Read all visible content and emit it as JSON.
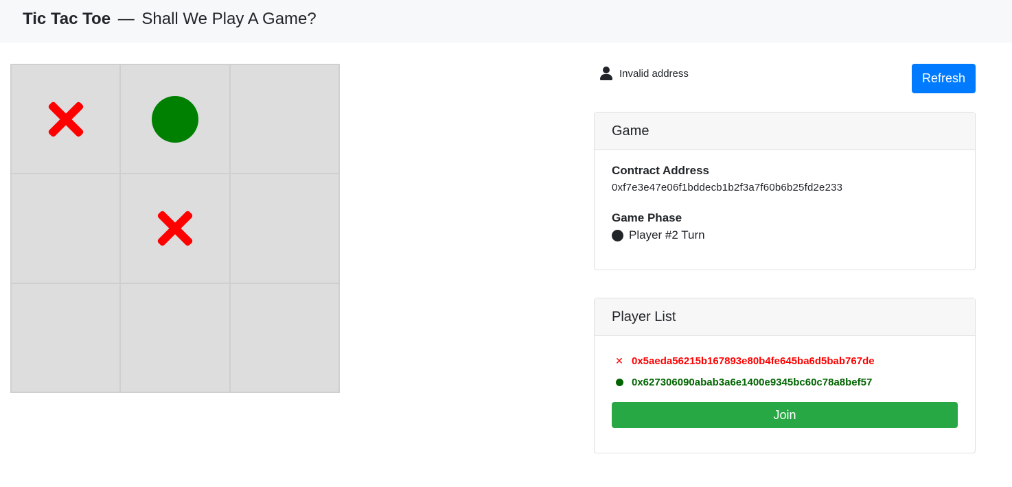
{
  "header": {
    "title": "Tic Tac Toe",
    "separator": "—",
    "subtitle": "Shall We Play A Game?"
  },
  "board": {
    "cells": [
      "X",
      "O",
      "",
      "",
      "X",
      "",
      "",
      "",
      ""
    ]
  },
  "account": {
    "icon": "user-icon",
    "status": "Invalid address"
  },
  "refresh_label": "Refresh",
  "game_card": {
    "header": "Game",
    "contract_label": "Contract Address",
    "contract_address": "0xf7e3e47e06f1bddecb1b2f3a7f60b6b25fd2e233",
    "phase_label": "Game Phase",
    "phase_value": "Player #2 Turn"
  },
  "player_card": {
    "header": "Player List",
    "players": [
      {
        "icon": "x-icon",
        "address": "0x5aeda56215b167893e80b4fe645ba6d5bab767de",
        "color": "#ff0000"
      },
      {
        "icon": "circle-icon",
        "address": "0x627306090abab3a6e1400e9345bc60c78a8bef57",
        "color": "#006400"
      }
    ],
    "join_label": "Join"
  },
  "colors": {
    "accent_blue": "#007bff",
    "join_green": "#28a745",
    "x_red": "#ff0000",
    "o_green": "#008000"
  }
}
